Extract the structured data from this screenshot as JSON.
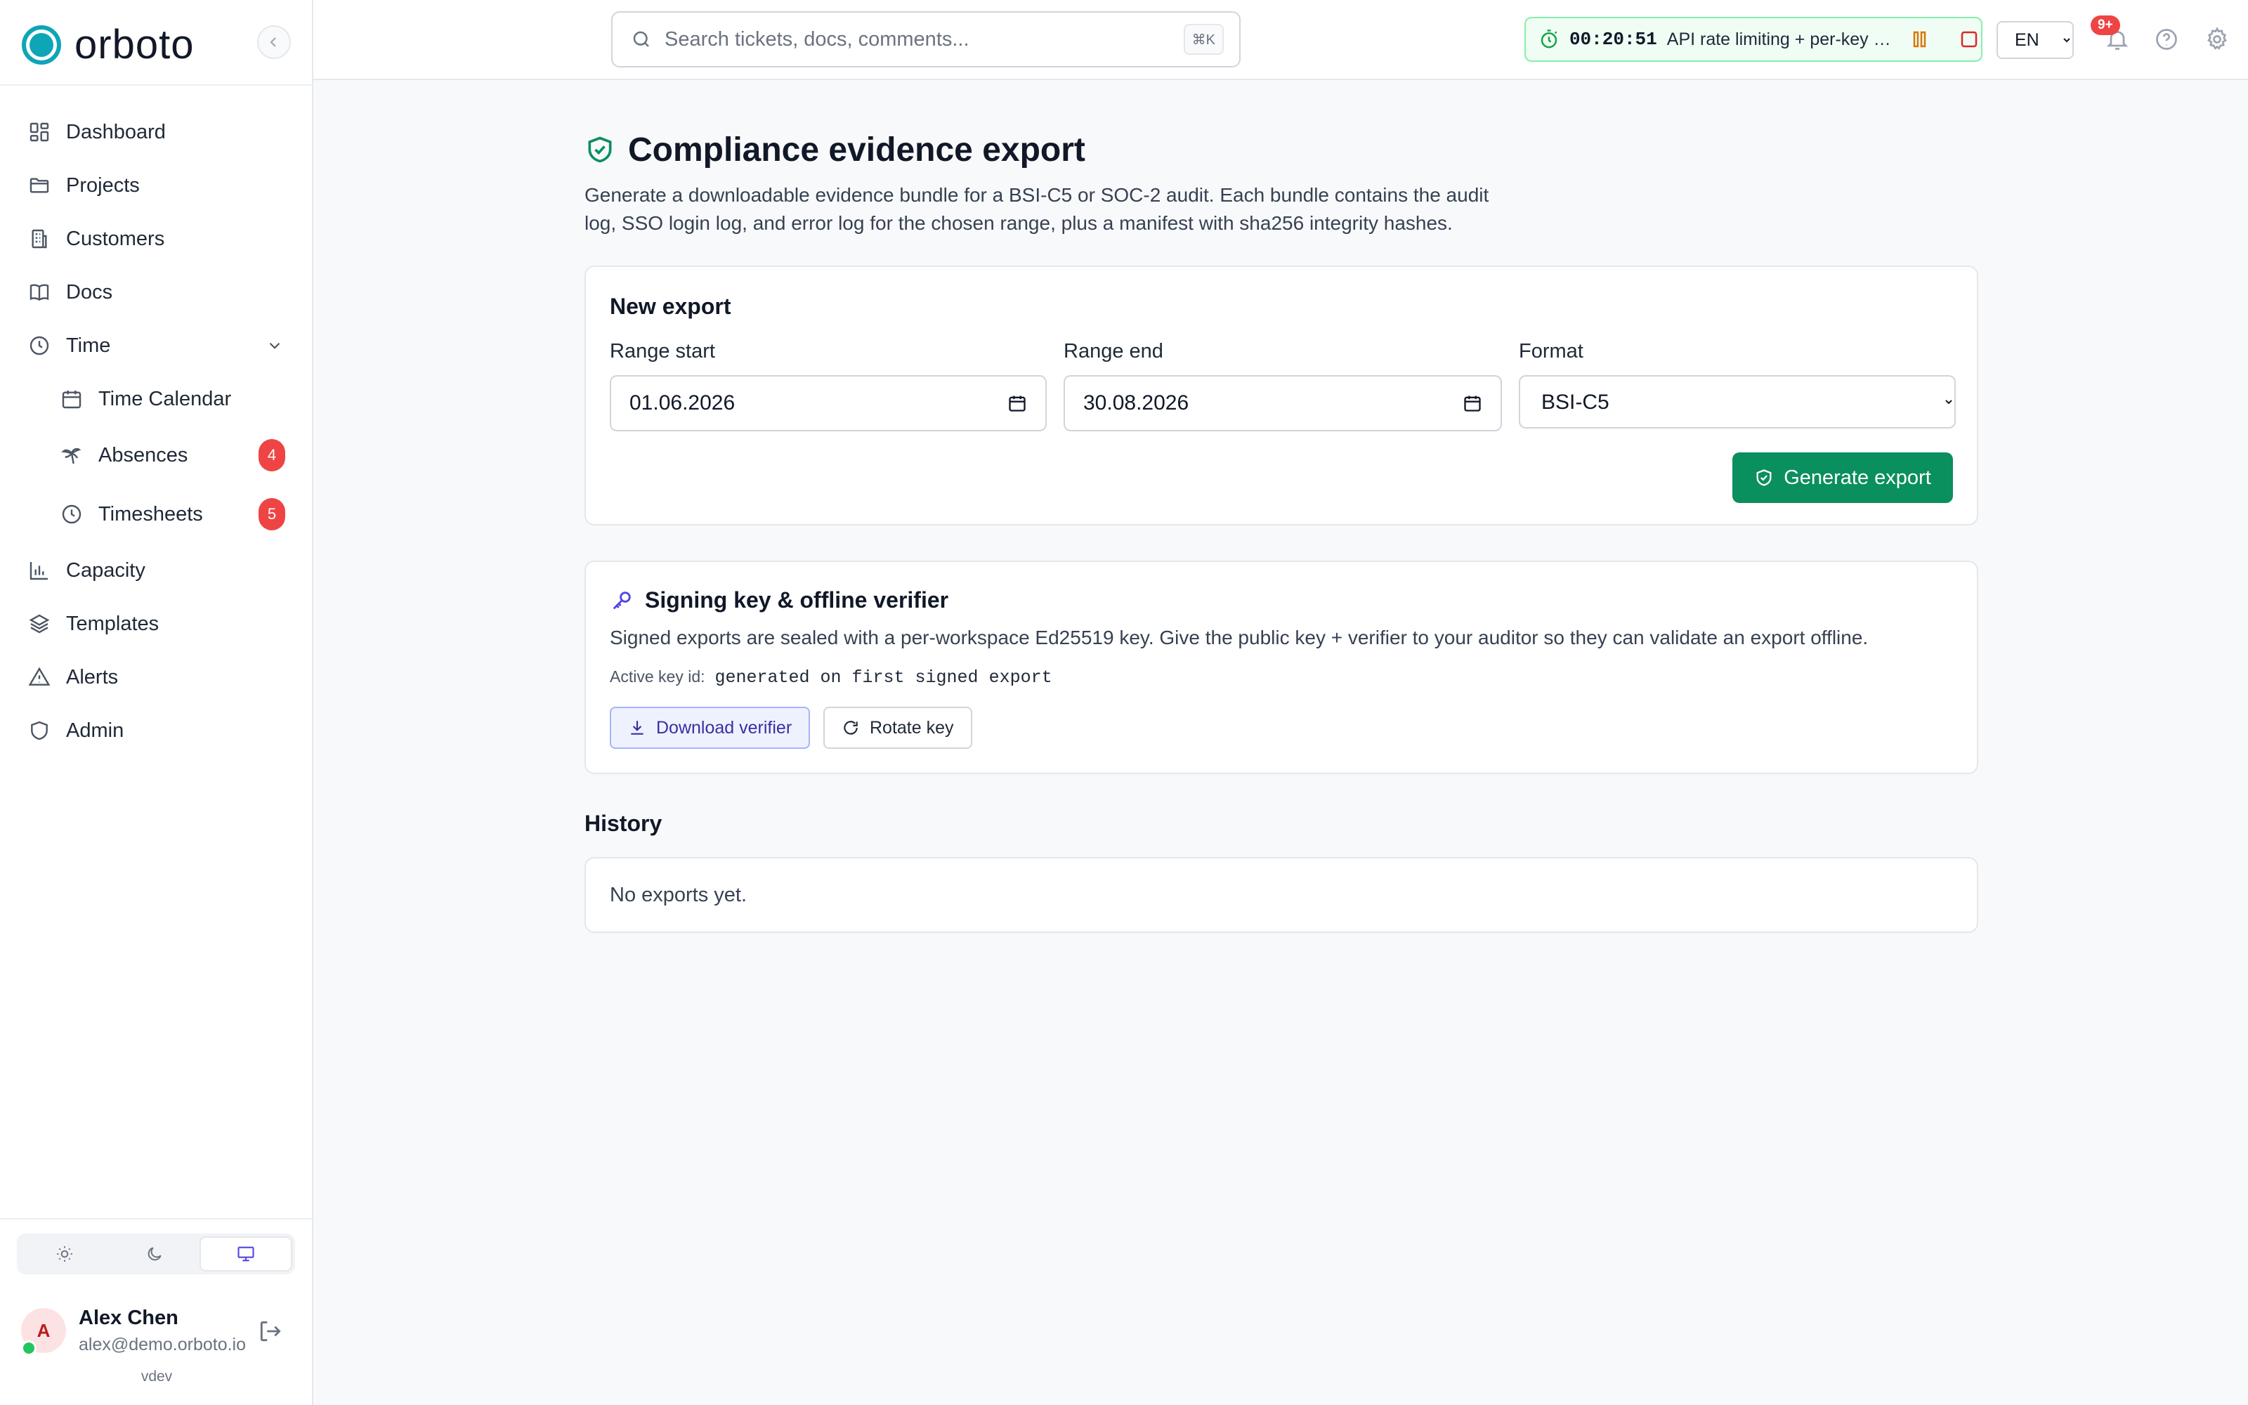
{
  "brand": {
    "name": "orboto",
    "accent": "#0ea5b7"
  },
  "sidebar": {
    "items": [
      {
        "label": "Dashboard",
        "icon": "dashboard-icon"
      },
      {
        "label": "Projects",
        "icon": "folder-icon"
      },
      {
        "label": "Customers",
        "icon": "building-icon"
      },
      {
        "label": "Docs",
        "icon": "book-icon"
      },
      {
        "label": "Time",
        "icon": "clock-icon"
      },
      {
        "label": "Time Calendar",
        "icon": "calendar-icon"
      },
      {
        "label": "Absences",
        "icon": "palm-tree-icon",
        "badge": "4"
      },
      {
        "label": "Timesheets",
        "icon": "clock-icon",
        "badge": "5"
      },
      {
        "label": "Capacity",
        "icon": "bar-chart-icon"
      },
      {
        "label": "Templates",
        "icon": "layers-icon"
      },
      {
        "label": "Alerts",
        "icon": "warning-icon"
      },
      {
        "label": "Admin",
        "icon": "shield-icon"
      }
    ],
    "user": {
      "initial": "A",
      "name": "Alex Chen",
      "email": "alex@demo.orboto.io"
    },
    "version": "vdev"
  },
  "topbar": {
    "search_placeholder": "Search tickets, docs, comments...",
    "search_shortcut": "⌘K",
    "timer": {
      "time": "00:20:51",
      "task": "API rate limiting + per-key quotas"
    },
    "language": "EN",
    "notifications_badge": "9+"
  },
  "page": {
    "title": "Compliance evidence export",
    "description": "Generate a downloadable evidence bundle for a BSI-C5 or SOC-2 audit. Each bundle contains the audit log, SSO login log, and error log for the chosen range, plus a manifest with sha256 integrity hashes.",
    "new_export": {
      "title": "New export",
      "range_start_label": "Range start",
      "range_start_value": "01.06.2026",
      "range_end_label": "Range end",
      "range_end_value": "30.08.2026",
      "format_label": "Format",
      "format_value": "BSI-C5",
      "generate_label": "Generate export"
    },
    "signing": {
      "title": "Signing key & offline verifier",
      "description": "Signed exports are sealed with a per-workspace Ed25519 key. Give the public key + verifier to your auditor so they can validate an export offline.",
      "key_id_label": "Active key id:",
      "key_id_value": "generated on first signed export",
      "download_label": "Download verifier",
      "rotate_label": "Rotate key"
    },
    "history": {
      "title": "History",
      "empty": "No exports yet."
    }
  },
  "colors": {
    "primary_green": "#0a8f5e",
    "badge_red": "#ef4444",
    "indigo": "#4f46e5"
  }
}
